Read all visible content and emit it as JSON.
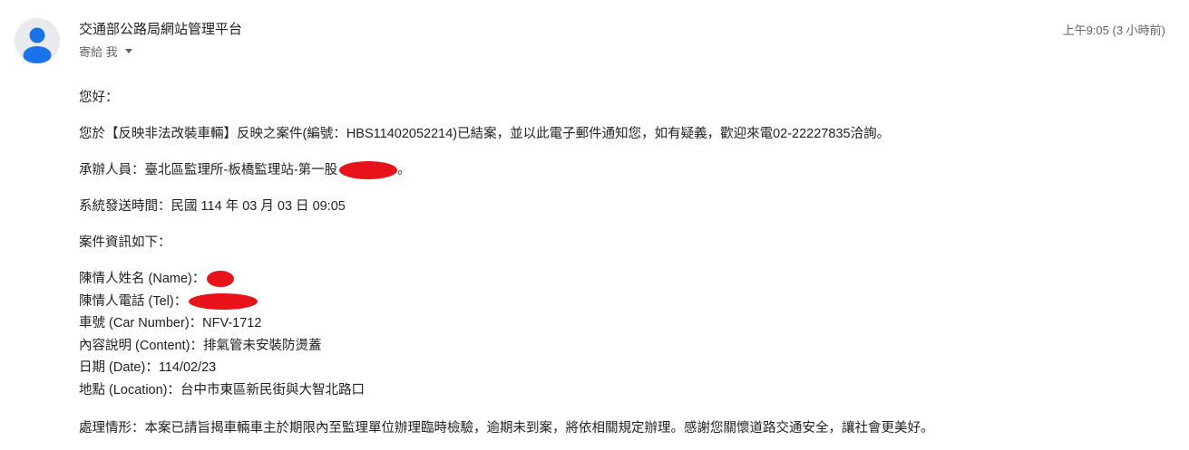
{
  "header": {
    "sender_name": "交通部公路局網站管理平台",
    "recipient_label": "寄給 我",
    "timestamp": "上午9:05 (3 小時前)"
  },
  "icons": {
    "avatar": "default-person-avatar-icon",
    "recipient_toggle": "caret-down-icon"
  },
  "colors": {
    "avatar_bg": "#e8eaed",
    "avatar_figure": "#1a73e8",
    "redaction": "#e8121b"
  },
  "body": {
    "greeting": "您好：",
    "notice": "您於【反映非法改裝車輛】反映之案件(編號：HBS11402052214)已結案，並以此電子郵件通知您，如有疑義，歡迎來電02-22227835洽詢。",
    "handler_label": "承辦人員：臺北區監理所-板橋監理站-第一股",
    "handler_suffix": "。",
    "sent_time": "系統發送時間：民國 114 年 03 月 03 日 09:05",
    "case_info_heading": "案件資訊如下：",
    "fields": {
      "name_label": "陳情人姓名 (Name)：",
      "tel_label": "陳情人電話 (Tel)：",
      "car_number": "車號 (Car Number)：NFV-1712",
      "content": "內容說明 (Content)：排氣管未安裝防燙蓋",
      "date": "日期 (Date)：114/02/23",
      "location": "地點 (Location)：台中市東區新民街與大智北路口"
    },
    "handling": "處理情形：本案已請旨揭車輛車主於期限內至監理單位辦理臨時檢驗，逾期未到案，將依相關規定辦理。感謝您關懷道路交通安全，讓社會更美好。"
  }
}
